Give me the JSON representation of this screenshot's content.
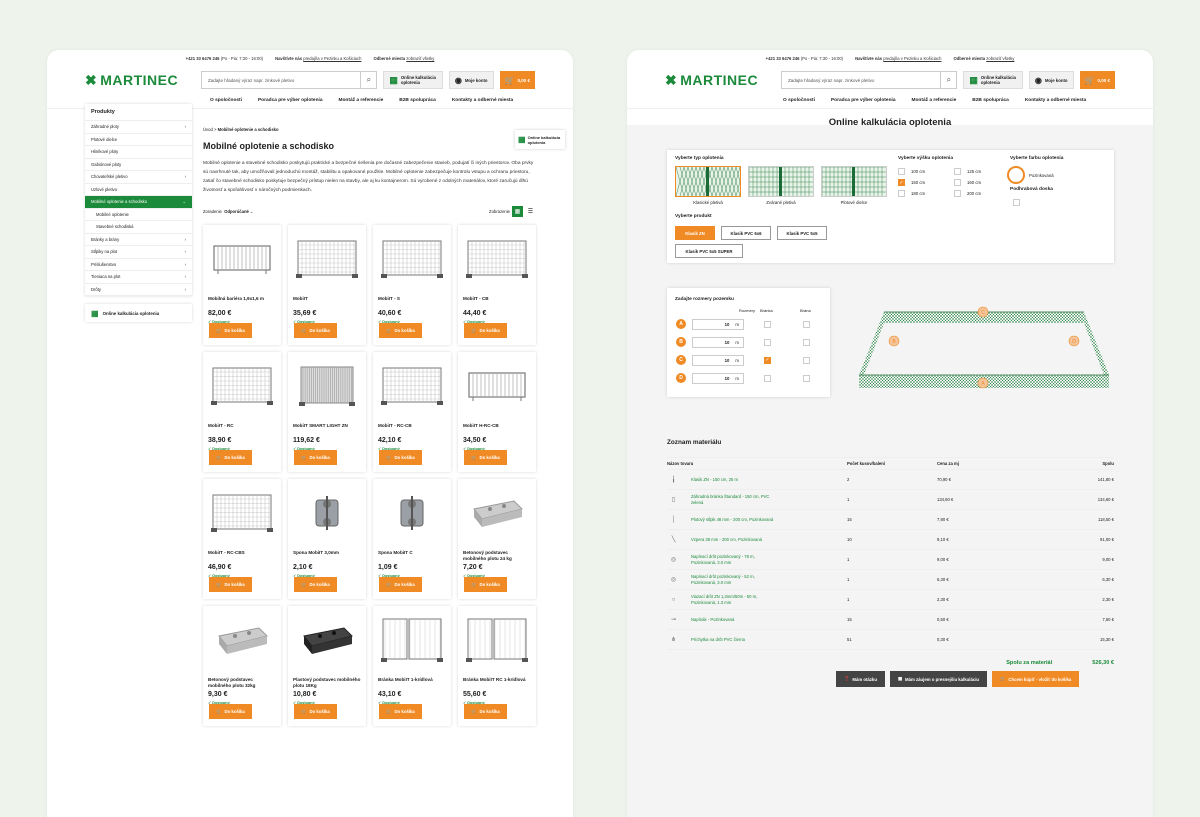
{
  "topbar": {
    "phone": "+421 33 6476 246",
    "hours": "(Po - Pia: 7:30 - 16:00)",
    "visit_label": "Navštívte nás",
    "visit_link": "predajňa v Pezinku a Košiciach",
    "pickup_label": "Odberné miesta",
    "pickup_link": "zobraziť všetky"
  },
  "header": {
    "logo": "MARTINEC",
    "search_placeholder": "Zadajte hľadaný výraz napr. zinkové pletivo",
    "calc_label": "Online kalkulácia oplotenia",
    "account_label": "Moje konto",
    "cart_count": "0",
    "cart_total": "0,00 €"
  },
  "nav": [
    "O spoločnosti",
    "Poradca pre výber oplotenia",
    "Montáž a referencie",
    "B2B spolupráca",
    "Kontakty a odberné miesta"
  ],
  "sidebar": {
    "title": "Produkty",
    "items": [
      {
        "label": "Záhradné ploty",
        "arrow": "›"
      },
      {
        "label": "Plotové dielce",
        "arrow": ""
      },
      {
        "label": "Hliníkové ploty",
        "arrow": ""
      },
      {
        "label": "Gabiónové ploty",
        "arrow": ""
      },
      {
        "label": "Chovateľské pletivo",
        "arrow": "›"
      },
      {
        "label": "Uzlové pletivo",
        "arrow": ""
      },
      {
        "label": "Mobilné oplotenie a schodisko",
        "arrow": "⌄"
      },
      {
        "label": "Mobilné oplotenie",
        "arrow": ""
      },
      {
        "label": "Stavebné schodiská",
        "arrow": ""
      },
      {
        "label": "Bránky a brány",
        "arrow": "›"
      },
      {
        "label": "Stĺpiky na plot",
        "arrow": "›"
      },
      {
        "label": "Príslušenstvo",
        "arrow": "›"
      },
      {
        "label": "Tieniaca na plot",
        "arrow": "›"
      },
      {
        "label": "Drôty",
        "arrow": "›"
      }
    ],
    "calc": "Online kalkulácia oplotenia"
  },
  "page1": {
    "breadcrumb_home": "Úvod",
    "breadcrumb_sep": ">",
    "breadcrumb_cur": "Mobilné oplotenie a schodisko",
    "title": "Mobilné oplotenie a schodisko",
    "description": "Mobilné oplotenie a stavebné schodisko poskytujú praktické a bezpečné riešenia pre dočasné zabezpečenie stavieb, podujatí či iných priestorov. Oba prvky sú navrhnuté tak, aby umožňovali jednoduchú montáž, stabilitu a opakované použitie. Mobilné oplotenie zabezpečuje kontrolu vstupu a ochranu priestoru, zatiaľ čo stavebné schodisko poskytuje bezpečný prístup nielen na stavby, ale aj ku kontajnerom. Sú vyrobené z odolných materiálov, ktoré zaručujú dlhú životnosť a spoľahlivosť v náročných podmienkach.",
    "sort_label": "Zoradenie",
    "sort_value": "Odporúčané",
    "view_label": "Zobrazenie",
    "calc_badge": "Online kalkulácia oplotenia",
    "add_label": "Do košíka",
    "avail": "✓ Dostupný",
    "products": [
      {
        "name": "Mobilná bariéra 1,9x1,6 m",
        "price": "82,00 €",
        "img": "barrier"
      },
      {
        "name": "MobiIT",
        "price": "35,69 €",
        "img": "fence"
      },
      {
        "name": "MobiIT - S",
        "price": "40,60 €",
        "img": "fence"
      },
      {
        "name": "MobiIT - CB",
        "price": "44,40 €",
        "img": "fence"
      },
      {
        "name": "MobiIT - RC",
        "price": "38,90 €",
        "img": "fence"
      },
      {
        "name": "MobiIT SMART LIGHT ZN",
        "price": "119,62 €",
        "img": "dense"
      },
      {
        "name": "MobiIT - RC-CB",
        "price": "42,10 €",
        "img": "fence"
      },
      {
        "name": "MobiIT H-RC-CB",
        "price": "34,50 €",
        "img": "barrier"
      },
      {
        "name": "MobiIT - RC-CBS",
        "price": "46,90 €",
        "img": "fence"
      },
      {
        "name": "Spona MobiIT 3,0mm",
        "price": "2,10 €",
        "img": "clamp"
      },
      {
        "name": "Spona MobiIT C",
        "price": "1,09 €",
        "img": "clamp"
      },
      {
        "name": "Betonový podstavec mobilného plotu 24 kg",
        "price": "7,20 €",
        "img": "block"
      },
      {
        "name": "Betonový podstavec mobilného plotu 32kg",
        "price": "9,30 €",
        "img": "block"
      },
      {
        "name": "Plastový podstavec mobilného plotu 18Kg",
        "price": "10,80 €",
        "img": "blackblock"
      },
      {
        "name": "Bránka MobiIT 1-krídlová",
        "price": "43,10 €",
        "img": "gate"
      },
      {
        "name": "Bránka MobiIT RC 1-krídlová",
        "price": "55,60 €",
        "img": "gate"
      }
    ]
  },
  "page2": {
    "title": "Online kalkulácia oplotenia",
    "type_label": "Vyberte typ oplotenia",
    "types": [
      "Klasické pletivá",
      "Zvárané pletivá",
      "Plotové dielce"
    ],
    "height_label": "Vyberte výšku oplotenia",
    "heights": [
      {
        "v": "100 cm",
        "on": false
      },
      {
        "v": "125 cm",
        "on": false
      },
      {
        "v": "150 cm",
        "on": true
      },
      {
        "v": "160 cm",
        "on": false
      },
      {
        "v": "180 cm",
        "on": false
      },
      {
        "v": "200 cm",
        "on": false
      }
    ],
    "color_label": "Vyberte farbu oplotenia",
    "color_value": "Pozinkovaná",
    "board_label": "Podhrabová doska",
    "product_label": "Vyberte produkt",
    "products": [
      "Klasik ZN",
      "Klasik PVC 6x6",
      "Klasik PVC 5x5",
      "Klasik PVC 5x5 SUPER"
    ],
    "dims_label": "Zadajte rozmery pozemku",
    "dims_cols": [
      "Rozmery",
      "Bránka",
      "Brána"
    ],
    "dims": [
      {
        "l": "A",
        "v": "10",
        "u": "m",
        "g": false
      },
      {
        "l": "B",
        "v": "10",
        "u": "m",
        "g": false
      },
      {
        "l": "C",
        "v": "10",
        "u": "m",
        "g": true
      },
      {
        "l": "D",
        "v": "10",
        "u": "m",
        "g": false
      }
    ],
    "materials_title": "Zoznam materiálu",
    "cols": [
      "Názov tovaru",
      "Počet kusov/balení",
      "Cena za mj",
      "Spolu"
    ],
    "rows": [
      {
        "icon": "╽",
        "name": "Klasik ZN - 150 cm, 25 m",
        "qty": "2",
        "unit": "70,90 €",
        "total": "141,80 €"
      },
      {
        "icon": "▯",
        "name": "Záhradná bránka Štandard - 150 cm, PVC zelená",
        "qty": "1",
        "unit": "134,60 €",
        "total": "134,60 €"
      },
      {
        "icon": "│",
        "name": "Plotový stĺpik 48 mm - 200 cm, Pozinkovaná",
        "qty": "15",
        "unit": "7,90 €",
        "total": "118,50 €"
      },
      {
        "icon": "╲",
        "name": "Vzpera 38 mm - 200 cm, Pozinkovaná",
        "qty": "10",
        "unit": "9,10 €",
        "total": "91,00 €"
      },
      {
        "icon": "◎",
        "name": "Napínací drôt pozinkovaný - 78 m, Pozinkovaná, 3.0 mm",
        "qty": "1",
        "unit": "9,00 €",
        "total": "9,00 €"
      },
      {
        "icon": "◎",
        "name": "Napínací drôt pozinkovaný - 52 m, Pozinkovaná, 3.0 mm",
        "qty": "1",
        "unit": "6,30 €",
        "total": "6,30 €"
      },
      {
        "icon": "○",
        "name": "Viazací drôt ZN 1,3mm/50m - 50 m, Pozinkovaná, 1.3 mm",
        "qty": "1",
        "unit": "2,30 €",
        "total": "2,30 €"
      },
      {
        "icon": "⊸",
        "name": "Napínák - Pozinkovaná",
        "qty": "15",
        "unit": "0,50 €",
        "total": "7,50 €"
      },
      {
        "icon": "⋔",
        "name": "Príchytka na drôt PVC čierna",
        "qty": "51",
        "unit": "0,30 €",
        "total": "15,30 €"
      }
    ],
    "total_label": "Spolu za materiál",
    "total_value": "526,30 €",
    "btn_question": "Mám otázku",
    "btn_interest": "Mám záujem o presnejšiu kalkuláciu",
    "btn_buy": "Chcem kúpiť - vložiť do košíka"
  },
  "colors": {
    "brand": "#1b8a3a",
    "accent": "#f08a24"
  }
}
